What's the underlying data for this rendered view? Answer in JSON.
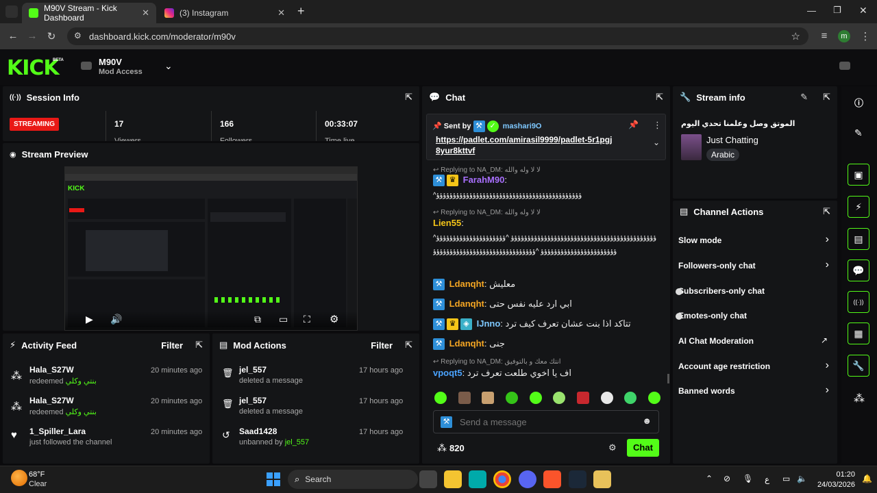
{
  "browser": {
    "tabs": [
      {
        "title": "M90V Stream - Kick Dashboard",
        "active": true
      },
      {
        "title": "(3) Instagram",
        "active": false
      }
    ],
    "url": "dashboard.kick.com/moderator/m90v",
    "profile_initial": "m"
  },
  "header": {
    "logo": "KICK",
    "logo_badge": "BETA",
    "channel_name": "M90V",
    "channel_role": "Mod Access"
  },
  "session": {
    "title": "Session Info",
    "status": "STREAMING",
    "stats": [
      {
        "value": "17",
        "label": "Viewers"
      },
      {
        "value": "166",
        "label": "Followers"
      },
      {
        "value": "00:33:07",
        "label": "Time live"
      }
    ]
  },
  "preview": {
    "title": "Stream Preview"
  },
  "activity": {
    "title": "Activity Feed",
    "filter": "Filter",
    "items": [
      {
        "user": "Hala_S27W",
        "action": "redeemed",
        "extra": "بنتي وكلي",
        "time": "20 minutes ago",
        "icon": "points-icon"
      },
      {
        "user": "Hala_S27W",
        "action": "redeemed",
        "extra": "بنتي وكلي",
        "time": "20 minutes ago",
        "icon": "points-icon"
      },
      {
        "user": "1_Spiller_Lara",
        "action": "just followed the channel",
        "extra": "",
        "time": "20 minutes ago",
        "icon": "heart-icon"
      }
    ]
  },
  "modactions": {
    "title": "Mod Actions",
    "filter": "Filter",
    "items": [
      {
        "user": "jel_557",
        "action": "deleted a message",
        "by": "",
        "time": "17 hours ago"
      },
      {
        "user": "jel_557",
        "action": "deleted a message",
        "by": "",
        "time": "17 hours ago"
      },
      {
        "user": "Saad1428",
        "action": "unbanned by",
        "by": "jel_557",
        "time": "17 hours ago"
      }
    ]
  },
  "chat": {
    "title": "Chat",
    "pinned": {
      "sent_by": "Sent by",
      "user": "mashari9O",
      "link": "https://padlet.com/amirasil9999/padlet-5r1pgj8yur8kttvf"
    },
    "messages": [
      {
        "reply": "Replying to NA_DM: لا لا وله والله",
        "user": "FarahM90",
        "color": "#a970ff",
        "text": ":",
        "body": "^ؤؤؤؤؤؤؤؤؤؤؤؤؤؤؤؤؤؤؤؤؤؤؤؤؤؤؤؤؤؤؤؤؤؤؤؤؤؤؤؤؤؤؤؤ"
      },
      {
        "reply": "Replying to NA_DM: لا لا وله والله",
        "user": "Lien55",
        "color": "#f5c518",
        "text": ":",
        "body": "^ؤؤؤؤؤؤؤؤؤؤؤؤؤؤؤؤؤؤؤؤؤؤؤؤؤؤؤؤؤؤؤؤؤؤؤؤؤؤؤؤؤؤؤؤ ^ؤؤؤؤؤؤؤؤؤؤؤؤؤؤؤؤؤؤؤؤؤؤؤؤؤؤؤؤؤؤؤؤؤؤؤؤؤؤؤؤؤؤؤؤ ^ؤؤؤؤؤؤؤؤؤؤؤؤؤؤؤؤؤؤؤؤؤؤؤؤؤؤؤؤؤؤؤ"
      },
      {
        "reply": "",
        "user": "Ldanqht",
        "color": "#f5a623",
        "text": ": معليش",
        "body": ""
      },
      {
        "reply": "",
        "user": "Ldanqht",
        "color": "#f5a623",
        "text": ": ابي ارد عليه نفس حتى",
        "body": ""
      },
      {
        "reply": "",
        "user": "IJnno",
        "color": "#7ec8ff",
        "text": ": تتاكد اذا بنت عشان تعرف كيف ترد",
        "body": ""
      },
      {
        "reply": "",
        "user": "Ldanqht",
        "color": "#f5a623",
        "text": ": جنى",
        "body": ""
      },
      {
        "reply": "Replying to NA_DM: انتك معك و بالتوفيق",
        "user": "vpoqt5",
        "color": "#4aa3ff",
        "text": ": اف يا اخوي طلعت تعرف ترد",
        "body": ""
      }
    ],
    "placeholder": "Send a message",
    "points": "820",
    "send": "Chat"
  },
  "streaminfo": {
    "title": "Stream info",
    "stream_title": "الموتق وصل وعلمنا تحدي اليوم",
    "category": "Just Chatting",
    "tag": "Arabic"
  },
  "channelactions": {
    "title": "Channel Actions",
    "items": [
      {
        "label": "Slow mode",
        "kind": "arrow"
      },
      {
        "label": "Followers-only chat",
        "kind": "arrow"
      },
      {
        "label": "Subscribers-only chat",
        "kind": "toggle"
      },
      {
        "label": "Emotes-only chat",
        "kind": "toggle"
      },
      {
        "label": "AI Chat Moderation",
        "kind": "external"
      },
      {
        "label": "Account age restriction",
        "kind": "arrow"
      },
      {
        "label": "Banned words",
        "kind": "arrow"
      }
    ]
  },
  "taskbar": {
    "weather_temp": "68°F",
    "weather_desc": "Clear",
    "search": "Search",
    "time": "01:20",
    "date": "24/03/2026",
    "lang": "ع"
  }
}
